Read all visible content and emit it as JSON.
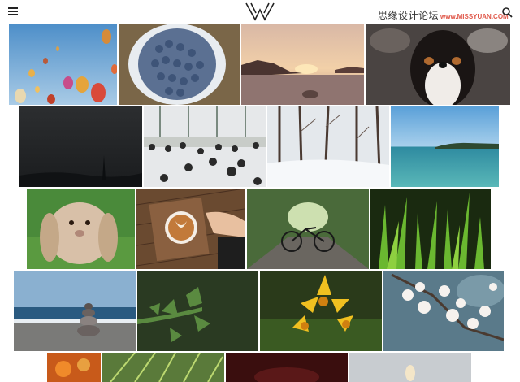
{
  "header": {
    "menu_icon": "hamburger-menu-icon",
    "logo_icon": "w-logo-icon",
    "search_icon": "search-icon",
    "watermark_cn": "思缘设计论坛",
    "watermark_url": "www.MISSYUAN.COM"
  },
  "gallery": {
    "photos": [
      {
        "id": "hot-air-balloons",
        "subject": "hot air balloons in blue sky"
      },
      {
        "id": "blueberries",
        "subject": "blueberries in white bowl"
      },
      {
        "id": "sunset-coast",
        "subject": "rocky coast at sunset"
      },
      {
        "id": "dog-portrait",
        "subject": "bernese mountain dog"
      },
      {
        "id": "dark-storm",
        "subject": "dark stormy sky with tower"
      },
      {
        "id": "aerial-people",
        "subject": "aerial view of people on platform"
      },
      {
        "id": "snowy-forest",
        "subject": "snow covered forest path"
      },
      {
        "id": "calm-sea",
        "subject": "calm turquoise sea with island"
      },
      {
        "id": "rabbit",
        "subject": "lop eared rabbit on grass"
      },
      {
        "id": "latte-art",
        "subject": "latte art coffee on wooden table"
      },
      {
        "id": "bicycle-path",
        "subject": "bicycle on forest path"
      },
      {
        "id": "green-grass",
        "subject": "green grass blades closeup"
      },
      {
        "id": "stone-cairn",
        "subject": "stacked stones on beach"
      },
      {
        "id": "pine-branch",
        "subject": "pine branch closeup"
      },
      {
        "id": "yellow-lilies",
        "subject": "yellow lily flowers"
      },
      {
        "id": "white-blossoms",
        "subject": "white blossoms on branch"
      },
      {
        "id": "autumn-partial",
        "subject": "orange autumn foliage"
      },
      {
        "id": "palm-partial",
        "subject": "palm leaves"
      },
      {
        "id": "dark-red-partial",
        "subject": "dark red photo"
      },
      {
        "id": "pale-partial",
        "subject": "pale bright photo"
      }
    ]
  },
  "colors": {
    "background": "#ffffff",
    "watermark_url": "#e0584a",
    "icon": "#222222"
  }
}
